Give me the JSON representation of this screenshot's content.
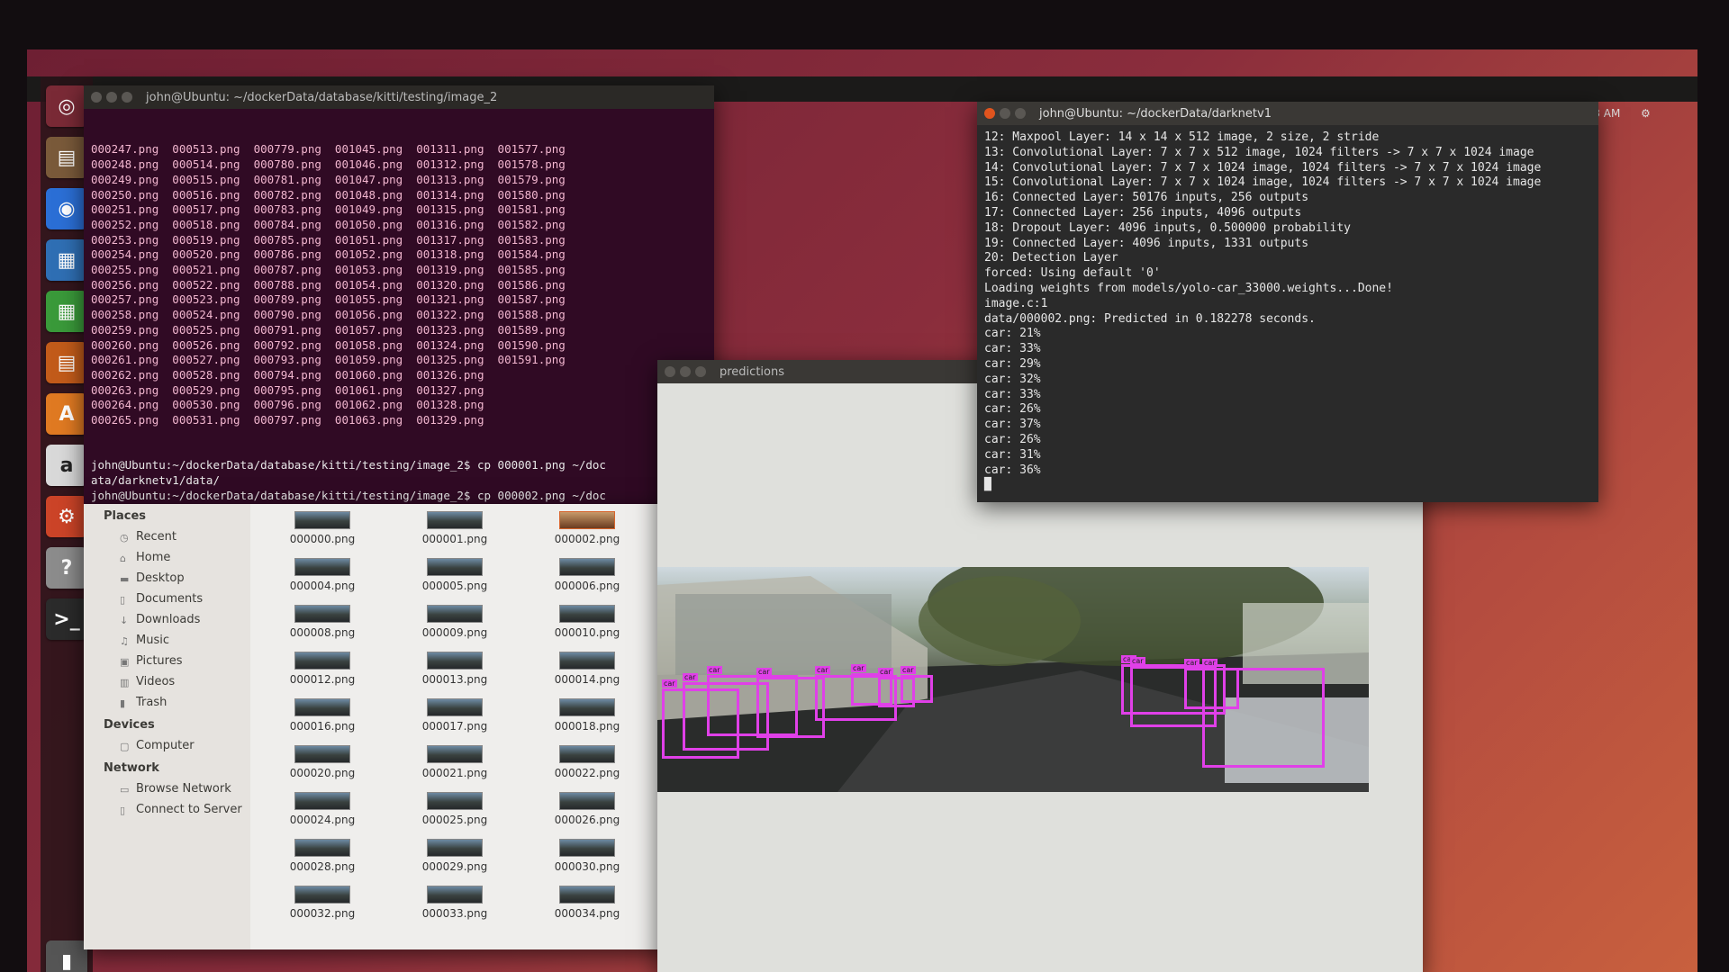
{
  "topbar": {
    "time": "9:43 AM"
  },
  "launcher": {
    "items": [
      {
        "name": "dash-icon",
        "glyph": "◎",
        "color": "#7a2a36"
      },
      {
        "name": "files-icon",
        "glyph": "▤",
        "color": "#7a5a3a"
      },
      {
        "name": "chromium-icon",
        "glyph": "◉",
        "color": "#2b6fd6"
      },
      {
        "name": "writer-icon",
        "glyph": "▦",
        "color": "#2f6fb4"
      },
      {
        "name": "calc-icon",
        "glyph": "▦",
        "color": "#3a9a3a"
      },
      {
        "name": "impress-icon",
        "glyph": "▤",
        "color": "#c25b1a"
      },
      {
        "name": "software-center-icon",
        "glyph": "A",
        "color": "#e07a22"
      },
      {
        "name": "amazon-icon",
        "glyph": "a",
        "color": "#d9d9d9"
      },
      {
        "name": "settings-icon",
        "glyph": "⚙",
        "color": "#cc4428"
      },
      {
        "name": "help-icon",
        "glyph": "?",
        "color": "#8c8c8c"
      },
      {
        "name": "terminal-icon",
        "glyph": ">_",
        "color": "#2b2b2b"
      }
    ],
    "trash": "trash-icon"
  },
  "term1": {
    "title": "john@Ubuntu: ~/dockerData/database/kitti/testing/image_2",
    "listing": [
      "000247.png  000513.png  000779.png  001045.png  001311.png  001577.png",
      "000248.png  000514.png  000780.png  001046.png  001312.png  001578.png",
      "000249.png  000515.png  000781.png  001047.png  001313.png  001579.png",
      "000250.png  000516.png  000782.png  001048.png  001314.png  001580.png",
      "000251.png  000517.png  000783.png  001049.png  001315.png  001581.png",
      "000252.png  000518.png  000784.png  001050.png  001316.png  001582.png",
      "000253.png  000519.png  000785.png  001051.png  001317.png  001583.png",
      "000254.png  000520.png  000786.png  001052.png  001318.png  001584.png",
      "000255.png  000521.png  000787.png  001053.png  001319.png  001585.png",
      "000256.png  000522.png  000788.png  001054.png  001320.png  001586.png",
      "000257.png  000523.png  000789.png  001055.png  001321.png  001587.png",
      "000258.png  000524.png  000790.png  001056.png  001322.png  001588.png",
      "000259.png  000525.png  000791.png  001057.png  001323.png  001589.png",
      "000260.png  000526.png  000792.png  001058.png  001324.png  001590.png",
      "000261.png  000527.png  000793.png  001059.png  001325.png  001591.png",
      "000262.png  000528.png  000794.png  001060.png  001326.png",
      "000263.png  000529.png  000795.png  001061.png  001327.png",
      "000264.png  000530.png  000796.png  001062.png  001328.png",
      "000265.png  000531.png  000797.png  001063.png  001329.png"
    ],
    "commands": [
      "john@Ubuntu:~/dockerData/database/kitti/testing/image_2$ cp 000001.png ~/doc",
      "ata/darknetv1/data/",
      "john@Ubuntu:~/dockerData/database/kitti/testing/image_2$ cp 000002.png ~/doc",
      "ata/darknetv1/data/",
      "john@Ubuntu:~/dockerData/database/kitti/testing/image_2$ "
    ]
  },
  "term2": {
    "title": "john@Ubuntu: ~/dockerData/darknetv1",
    "lines": [
      "12: Maxpool Layer: 14 x 14 x 512 image, 2 size, 2 stride",
      "13: Convolutional Layer: 7 x 7 x 512 image, 1024 filters -> 7 x 7 x 1024 image",
      "14: Convolutional Layer: 7 x 7 x 1024 image, 1024 filters -> 7 x 7 x 1024 image",
      "15: Convolutional Layer: 7 x 7 x 1024 image, 1024 filters -> 7 x 7 x 1024 image",
      "16: Connected Layer: 50176 inputs, 256 outputs",
      "17: Connected Layer: 256 inputs, 4096 outputs",
      "18: Dropout Layer: 4096 inputs, 0.500000 probability",
      "19: Connected Layer: 4096 inputs, 1331 outputs",
      "20: Detection Layer",
      "forced: Using default '0'",
      "Loading weights from models/yolo-car_33000.weights...Done!",
      "image.c:1",
      "data/000002.png: Predicted in 0.182278 seconds.",
      "car: 21%",
      "car: 33%",
      "car: 29%",
      "car: 32%",
      "car: 33%",
      "car: 26%",
      "car: 37%",
      "car: 26%",
      "car: 31%",
      "car: 36%"
    ]
  },
  "nautilus": {
    "sections": [
      {
        "header": "Places",
        "items": [
          {
            "label": "Recent",
            "icon": "clock-icon",
            "glyph": "◷"
          },
          {
            "label": "Home",
            "icon": "home-icon",
            "glyph": "⌂"
          },
          {
            "label": "Desktop",
            "icon": "desktop-folder-icon",
            "glyph": "▬"
          },
          {
            "label": "Documents",
            "icon": "document-icon",
            "glyph": "▯"
          },
          {
            "label": "Downloads",
            "icon": "download-icon",
            "glyph": "↓"
          },
          {
            "label": "Music",
            "icon": "music-icon",
            "glyph": "♫"
          },
          {
            "label": "Pictures",
            "icon": "camera-icon",
            "glyph": "▣"
          },
          {
            "label": "Videos",
            "icon": "film-icon",
            "glyph": "▥"
          },
          {
            "label": "Trash",
            "icon": "trash-icon",
            "glyph": "▮"
          }
        ]
      },
      {
        "header": "Devices",
        "items": [
          {
            "label": "Computer",
            "icon": "computer-icon",
            "glyph": "▢"
          }
        ]
      },
      {
        "header": "Network",
        "items": [
          {
            "label": "Browse Network",
            "icon": "network-icon",
            "glyph": "▭"
          },
          {
            "label": "Connect to Server",
            "icon": "server-icon",
            "glyph": "▯"
          }
        ]
      }
    ],
    "files": [
      [
        "000000.png",
        "000001.png",
        "000002.png"
      ],
      [
        "000004.png",
        "000005.png",
        "000006.png"
      ],
      [
        "000008.png",
        "000009.png",
        "000010.png"
      ],
      [
        "000012.png",
        "000013.png",
        "000014.png"
      ],
      [
        "000016.png",
        "000017.png",
        "000018.png"
      ],
      [
        "000020.png",
        "000021.png",
        "000022.png"
      ],
      [
        "000024.png",
        "000025.png",
        "000026.png"
      ],
      [
        "000028.png",
        "000029.png",
        "000030.png"
      ],
      [
        "000032.png",
        "000033.png",
        "000034.png"
      ]
    ],
    "selected_file": "000002.png"
  },
  "predictions": {
    "title": "predictions",
    "label": "car",
    "box_color": "#e040e8"
  }
}
